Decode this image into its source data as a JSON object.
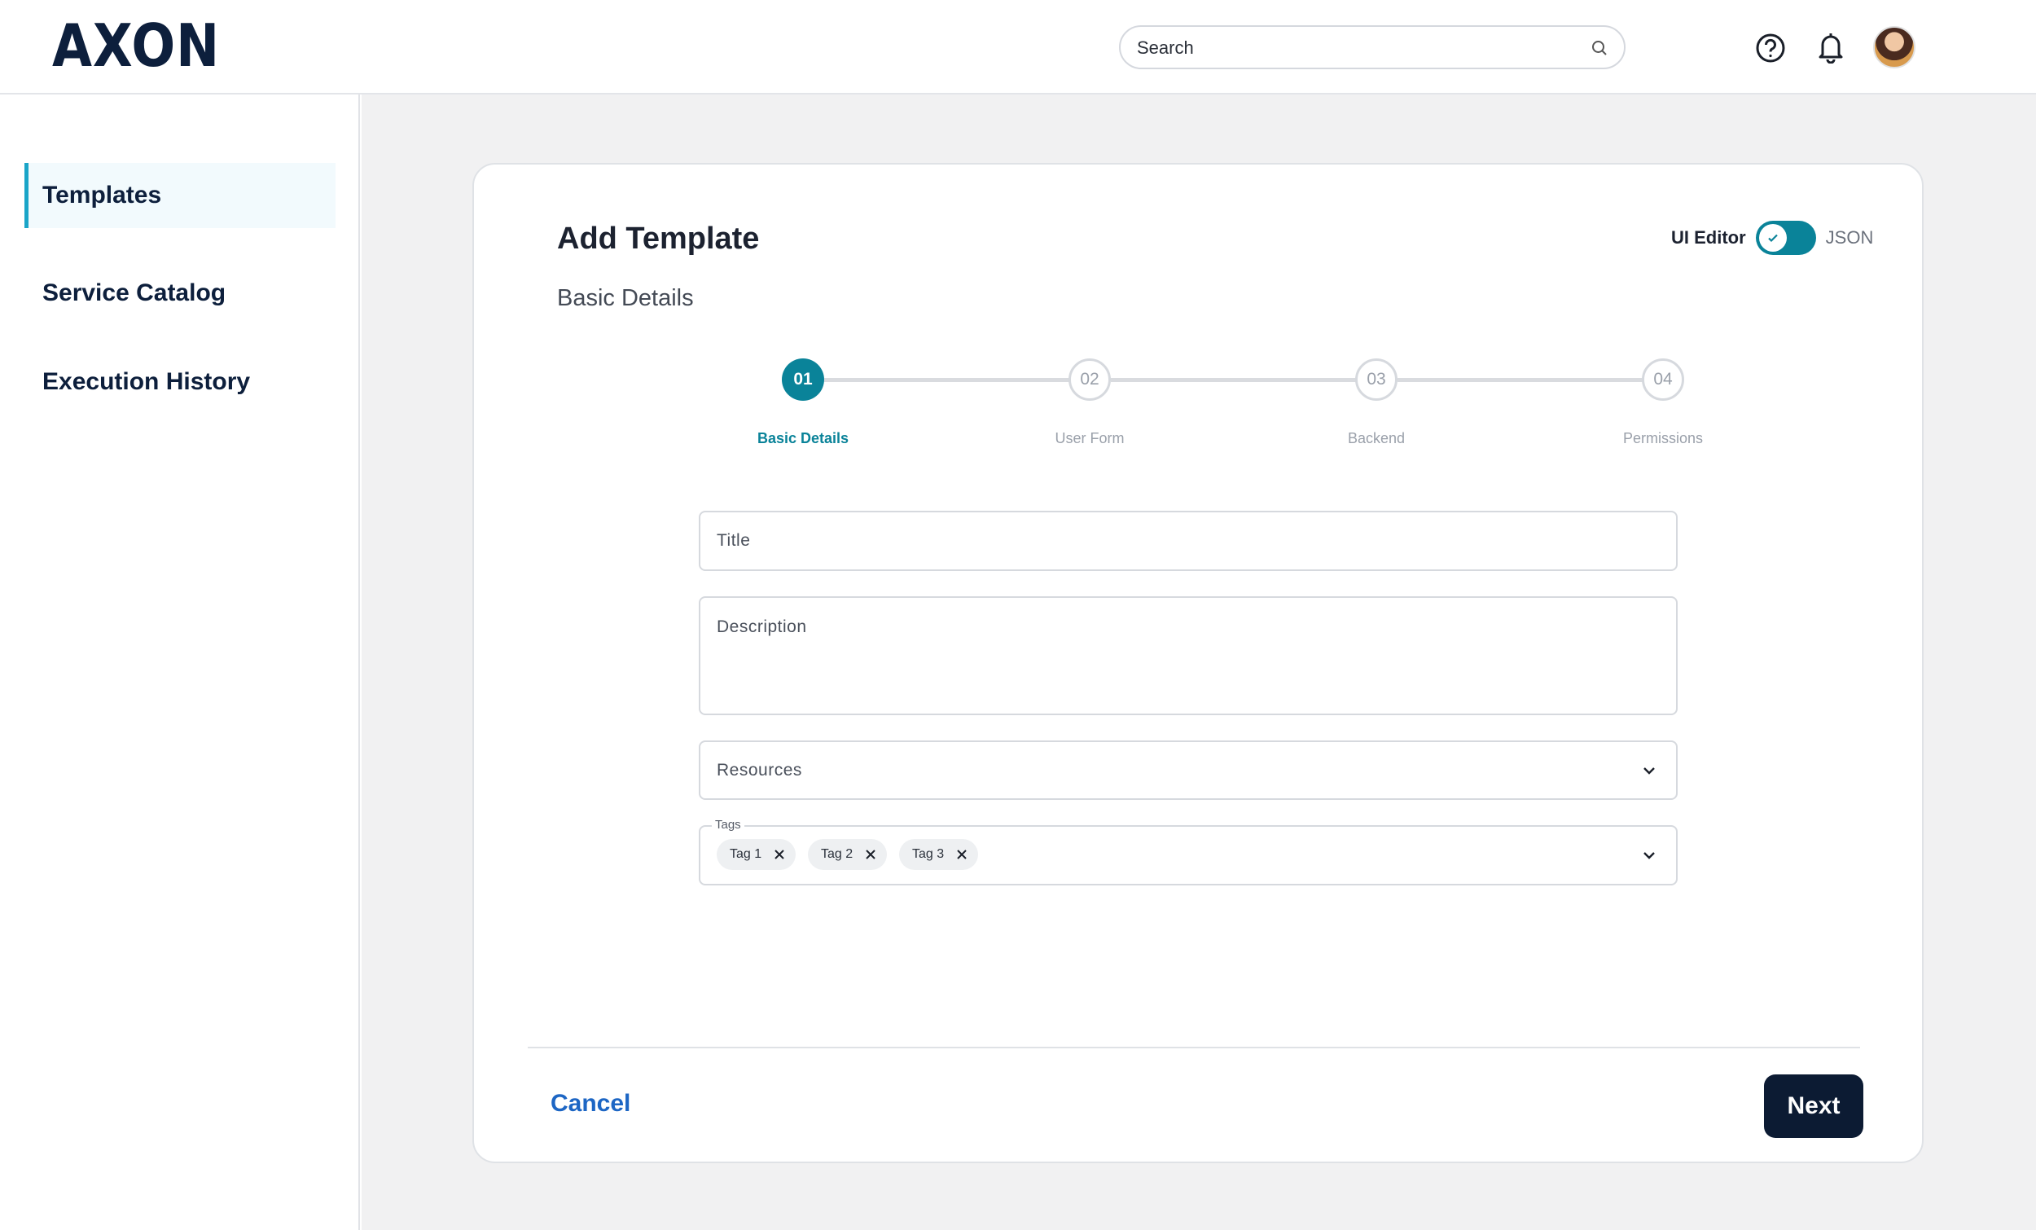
{
  "header": {
    "logo": "AXON",
    "search": {
      "placeholder": "Search"
    }
  },
  "sidebar": {
    "items": [
      {
        "label": "Templates",
        "active": true
      },
      {
        "label": "Service Catalog",
        "active": false
      },
      {
        "label": "Execution History",
        "active": false
      }
    ]
  },
  "card": {
    "title": "Add Template",
    "section_title": "Basic Details",
    "editor_toggle": {
      "left_label": "UI Editor",
      "right_label": "JSON",
      "state": "UI Editor"
    }
  },
  "stepper": {
    "steps": [
      {
        "number": "01",
        "label": "Basic Details",
        "active": true
      },
      {
        "number": "02",
        "label": "User Form",
        "active": false
      },
      {
        "number": "03",
        "label": "Backend",
        "active": false
      },
      {
        "number": "04",
        "label": "Permissions",
        "active": false
      }
    ]
  },
  "form": {
    "title": {
      "placeholder": "Title",
      "value": ""
    },
    "description": {
      "placeholder": "Description",
      "value": ""
    },
    "resources": {
      "placeholder": "Resources"
    },
    "tags": {
      "label": "Tags",
      "values": [
        "Tag 1",
        "Tag 2",
        "Tag 3"
      ]
    }
  },
  "footer": {
    "cancel_label": "Cancel",
    "next_label": "Next"
  },
  "colors": {
    "accent": "#0a8399",
    "sidebar_active_bar": "#1aa5c8",
    "primary_button": "#0c1b33",
    "link": "#1d66c4"
  }
}
